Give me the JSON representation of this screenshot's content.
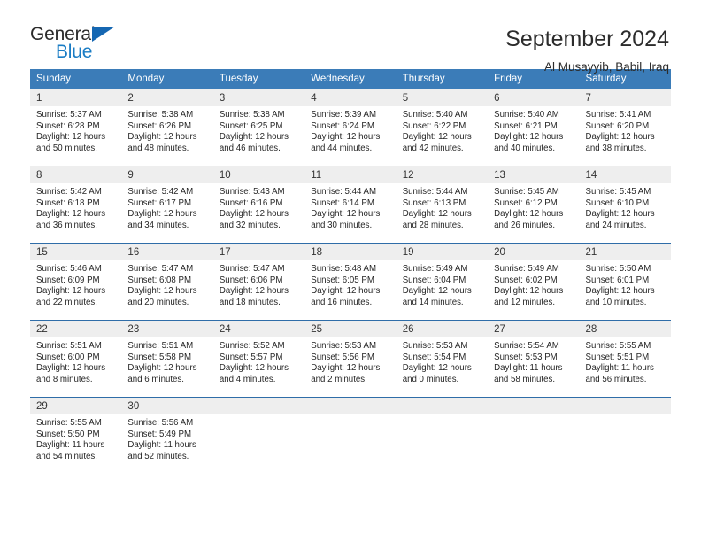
{
  "brand": {
    "word_top": "General",
    "word_bottom": "Blue",
    "triangle_color": "#1567b2",
    "blue_color": "#1a7cc4"
  },
  "header": {
    "title": "September 2024",
    "subtitle": "Al Musayyib, Babil, Iraq"
  },
  "theme": {
    "header_row_bg": "#3b7cb8",
    "row_border": "#2f6da8",
    "daynum_bg": "#eeeeee"
  },
  "weekdays": [
    "Sunday",
    "Monday",
    "Tuesday",
    "Wednesday",
    "Thursday",
    "Friday",
    "Saturday"
  ],
  "weeks": [
    [
      {
        "day": "1",
        "sunrise": "Sunrise: 5:37 AM",
        "sunset": "Sunset: 6:28 PM",
        "daylight1": "Daylight: 12 hours",
        "daylight2": "and 50 minutes."
      },
      {
        "day": "2",
        "sunrise": "Sunrise: 5:38 AM",
        "sunset": "Sunset: 6:26 PM",
        "daylight1": "Daylight: 12 hours",
        "daylight2": "and 48 minutes."
      },
      {
        "day": "3",
        "sunrise": "Sunrise: 5:38 AM",
        "sunset": "Sunset: 6:25 PM",
        "daylight1": "Daylight: 12 hours",
        "daylight2": "and 46 minutes."
      },
      {
        "day": "4",
        "sunrise": "Sunrise: 5:39 AM",
        "sunset": "Sunset: 6:24 PM",
        "daylight1": "Daylight: 12 hours",
        "daylight2": "and 44 minutes."
      },
      {
        "day": "5",
        "sunrise": "Sunrise: 5:40 AM",
        "sunset": "Sunset: 6:22 PM",
        "daylight1": "Daylight: 12 hours",
        "daylight2": "and 42 minutes."
      },
      {
        "day": "6",
        "sunrise": "Sunrise: 5:40 AM",
        "sunset": "Sunset: 6:21 PM",
        "daylight1": "Daylight: 12 hours",
        "daylight2": "and 40 minutes."
      },
      {
        "day": "7",
        "sunrise": "Sunrise: 5:41 AM",
        "sunset": "Sunset: 6:20 PM",
        "daylight1": "Daylight: 12 hours",
        "daylight2": "and 38 minutes."
      }
    ],
    [
      {
        "day": "8",
        "sunrise": "Sunrise: 5:42 AM",
        "sunset": "Sunset: 6:18 PM",
        "daylight1": "Daylight: 12 hours",
        "daylight2": "and 36 minutes."
      },
      {
        "day": "9",
        "sunrise": "Sunrise: 5:42 AM",
        "sunset": "Sunset: 6:17 PM",
        "daylight1": "Daylight: 12 hours",
        "daylight2": "and 34 minutes."
      },
      {
        "day": "10",
        "sunrise": "Sunrise: 5:43 AM",
        "sunset": "Sunset: 6:16 PM",
        "daylight1": "Daylight: 12 hours",
        "daylight2": "and 32 minutes."
      },
      {
        "day": "11",
        "sunrise": "Sunrise: 5:44 AM",
        "sunset": "Sunset: 6:14 PM",
        "daylight1": "Daylight: 12 hours",
        "daylight2": "and 30 minutes."
      },
      {
        "day": "12",
        "sunrise": "Sunrise: 5:44 AM",
        "sunset": "Sunset: 6:13 PM",
        "daylight1": "Daylight: 12 hours",
        "daylight2": "and 28 minutes."
      },
      {
        "day": "13",
        "sunrise": "Sunrise: 5:45 AM",
        "sunset": "Sunset: 6:12 PM",
        "daylight1": "Daylight: 12 hours",
        "daylight2": "and 26 minutes."
      },
      {
        "day": "14",
        "sunrise": "Sunrise: 5:45 AM",
        "sunset": "Sunset: 6:10 PM",
        "daylight1": "Daylight: 12 hours",
        "daylight2": "and 24 minutes."
      }
    ],
    [
      {
        "day": "15",
        "sunrise": "Sunrise: 5:46 AM",
        "sunset": "Sunset: 6:09 PM",
        "daylight1": "Daylight: 12 hours",
        "daylight2": "and 22 minutes."
      },
      {
        "day": "16",
        "sunrise": "Sunrise: 5:47 AM",
        "sunset": "Sunset: 6:08 PM",
        "daylight1": "Daylight: 12 hours",
        "daylight2": "and 20 minutes."
      },
      {
        "day": "17",
        "sunrise": "Sunrise: 5:47 AM",
        "sunset": "Sunset: 6:06 PM",
        "daylight1": "Daylight: 12 hours",
        "daylight2": "and 18 minutes."
      },
      {
        "day": "18",
        "sunrise": "Sunrise: 5:48 AM",
        "sunset": "Sunset: 6:05 PM",
        "daylight1": "Daylight: 12 hours",
        "daylight2": "and 16 minutes."
      },
      {
        "day": "19",
        "sunrise": "Sunrise: 5:49 AM",
        "sunset": "Sunset: 6:04 PM",
        "daylight1": "Daylight: 12 hours",
        "daylight2": "and 14 minutes."
      },
      {
        "day": "20",
        "sunrise": "Sunrise: 5:49 AM",
        "sunset": "Sunset: 6:02 PM",
        "daylight1": "Daylight: 12 hours",
        "daylight2": "and 12 minutes."
      },
      {
        "day": "21",
        "sunrise": "Sunrise: 5:50 AM",
        "sunset": "Sunset: 6:01 PM",
        "daylight1": "Daylight: 12 hours",
        "daylight2": "and 10 minutes."
      }
    ],
    [
      {
        "day": "22",
        "sunrise": "Sunrise: 5:51 AM",
        "sunset": "Sunset: 6:00 PM",
        "daylight1": "Daylight: 12 hours",
        "daylight2": "and 8 minutes."
      },
      {
        "day": "23",
        "sunrise": "Sunrise: 5:51 AM",
        "sunset": "Sunset: 5:58 PM",
        "daylight1": "Daylight: 12 hours",
        "daylight2": "and 6 minutes."
      },
      {
        "day": "24",
        "sunrise": "Sunrise: 5:52 AM",
        "sunset": "Sunset: 5:57 PM",
        "daylight1": "Daylight: 12 hours",
        "daylight2": "and 4 minutes."
      },
      {
        "day": "25",
        "sunrise": "Sunrise: 5:53 AM",
        "sunset": "Sunset: 5:56 PM",
        "daylight1": "Daylight: 12 hours",
        "daylight2": "and 2 minutes."
      },
      {
        "day": "26",
        "sunrise": "Sunrise: 5:53 AM",
        "sunset": "Sunset: 5:54 PM",
        "daylight1": "Daylight: 12 hours",
        "daylight2": "and 0 minutes."
      },
      {
        "day": "27",
        "sunrise": "Sunrise: 5:54 AM",
        "sunset": "Sunset: 5:53 PM",
        "daylight1": "Daylight: 11 hours",
        "daylight2": "and 58 minutes."
      },
      {
        "day": "28",
        "sunrise": "Sunrise: 5:55 AM",
        "sunset": "Sunset: 5:51 PM",
        "daylight1": "Daylight: 11 hours",
        "daylight2": "and 56 minutes."
      }
    ],
    [
      {
        "day": "29",
        "sunrise": "Sunrise: 5:55 AM",
        "sunset": "Sunset: 5:50 PM",
        "daylight1": "Daylight: 11 hours",
        "daylight2": "and 54 minutes."
      },
      {
        "day": "30",
        "sunrise": "Sunrise: 5:56 AM",
        "sunset": "Sunset: 5:49 PM",
        "daylight1": "Daylight: 11 hours",
        "daylight2": "and 52 minutes."
      },
      {
        "day": "",
        "sunrise": "",
        "sunset": "",
        "daylight1": "",
        "daylight2": ""
      },
      {
        "day": "",
        "sunrise": "",
        "sunset": "",
        "daylight1": "",
        "daylight2": ""
      },
      {
        "day": "",
        "sunrise": "",
        "sunset": "",
        "daylight1": "",
        "daylight2": ""
      },
      {
        "day": "",
        "sunrise": "",
        "sunset": "",
        "daylight1": "",
        "daylight2": ""
      },
      {
        "day": "",
        "sunrise": "",
        "sunset": "",
        "daylight1": "",
        "daylight2": ""
      }
    ]
  ]
}
